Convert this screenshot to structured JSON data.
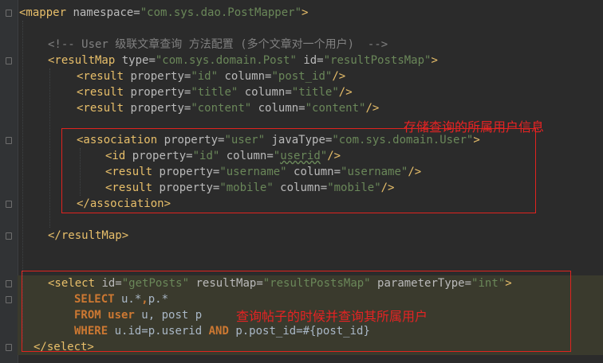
{
  "code": {
    "mapper_open": {
      "tag": "<mapper",
      "attr": " namespace=",
      "val": "\"com.sys.dao.PostMapper\"",
      "end": ">"
    },
    "comment": "<!-- User 级联文章查询 方法配置 (多个文章对一个用户)  -->",
    "resultmap_open": {
      "tag": "<resultMap",
      "a1": " type=",
      "v1": "\"com.sys.domain.Post\"",
      "a2": " id=",
      "v2": "\"resultPostsMap\"",
      "end": ">"
    },
    "result1": {
      "tag": "<result",
      "a1": " property=",
      "v1": "\"id\"",
      "a2": " column=",
      "v2": "\"post_id\"",
      "end": "/>"
    },
    "result2": {
      "tag": "<result",
      "a1": " property=",
      "v1": "\"title\"",
      "a2": " column=",
      "v2": "\"title\"",
      "end": "/>"
    },
    "result3": {
      "tag": "<result",
      "a1": " property=",
      "v1": "\"content\"",
      "a2": " column=",
      "v2": "\"content\"",
      "end": "/>"
    },
    "assoc_open": {
      "tag": "<association",
      "a1": " property=",
      "v1": "\"user\"",
      "a2": " javaType=",
      "v2": "\"com.sys.domain.User\"",
      "end": ">"
    },
    "assoc_id": {
      "tag": "<id",
      "a1": " property=",
      "v1": "\"id\"",
      "a2": " column=",
      "v2q": "\"",
      "v2": "userid",
      "v2e": "\"",
      "end": "/>"
    },
    "assoc_r1": {
      "tag": "<result",
      "a1": " property=",
      "v1": "\"username\"",
      "a2": " column=",
      "v2": "\"username\"",
      "end": "/>"
    },
    "assoc_r2": {
      "tag": "<result",
      "a1": " property=",
      "v1": "\"mobile\"",
      "a2": " column=",
      "v2": "\"mobile\"",
      "end": "/>"
    },
    "assoc_close": "</association>",
    "resultmap_close": "</resultMap>",
    "select_open": {
      "tag": "<select",
      "a1": " id=",
      "v1": "\"getPosts\"",
      "a2": " resultMap=",
      "v2": "\"resultPostsMap\"",
      "a3": " parameterType=",
      "v3": "\"int\"",
      "end": ">"
    },
    "sql1": {
      "kw": "SELECT",
      "rest": " u.*",
      "comma": ",",
      "rest2": "p.*"
    },
    "sql2": {
      "kw": "FROM",
      "kw2": " user",
      "rest": " u, post p"
    },
    "sql3": {
      "kw": "WHERE",
      "rest": " u.id=p.userid ",
      "kw2": "AND",
      "rest2": " p.post_id=#{post_id}"
    },
    "select_close": "</select>"
  },
  "annotations": {
    "association_note": "存储查询的所属用户信息",
    "select_note": "查询帖子的时候并查询其所属用户"
  },
  "colors": {
    "background": "#2b2b2b",
    "tag": "#e8bf6a",
    "attribute": "#bababa",
    "value": "#6a8759",
    "comment": "#808080",
    "keyword": "#cc7832",
    "annotation": "#e62323"
  }
}
